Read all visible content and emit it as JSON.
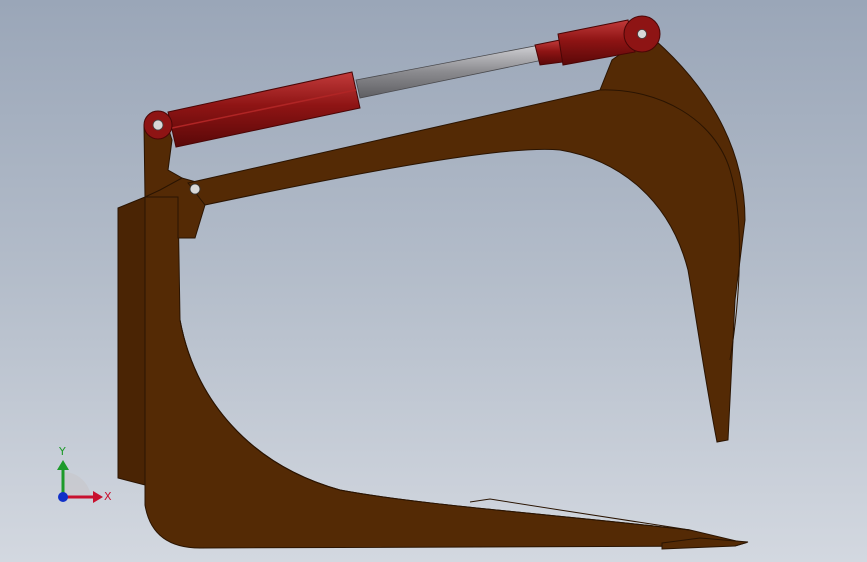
{
  "viewport": {
    "background_top": "#9aa6b8",
    "background_bottom": "#d3d8e0"
  },
  "model": {
    "body_color": "#542a05",
    "edge_color": "#2a1402",
    "cylinder_color": "#8e1414",
    "cylinder_highlight": "#c23b3b",
    "rod_color": "#8c8c90"
  },
  "triad": {
    "y_label": "Y",
    "x_label": "X",
    "y_color": "#1d9a2a",
    "x_color": "#c8102e",
    "z_color": "#1030c8"
  }
}
